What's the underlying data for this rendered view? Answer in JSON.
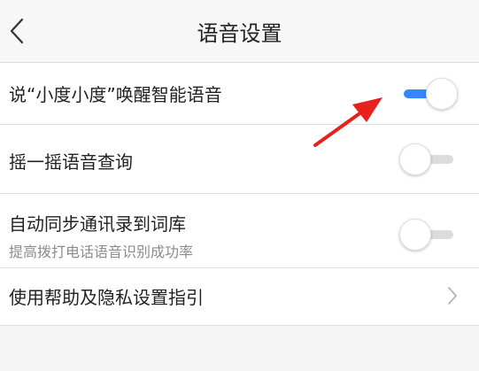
{
  "header": {
    "title": "语音设置",
    "back_icon": "chevron-left-icon"
  },
  "settings": [
    {
      "label": "说“小度小度”唤醒智能语音",
      "toggle": true
    },
    {
      "label": "摇一摇语音查询",
      "toggle": false
    },
    {
      "label": "自动同步通讯录到词库",
      "sublabel": "提高拨打电话语音识别成功率",
      "toggle": false
    },
    {
      "label": "使用帮助及隐私设置指引",
      "chevron_icon": "chevron-right-icon"
    }
  ],
  "colors": {
    "accent": "#3388ff",
    "annotation_arrow": "#e8201e",
    "toggle_off_track": "#dcdcdc"
  }
}
